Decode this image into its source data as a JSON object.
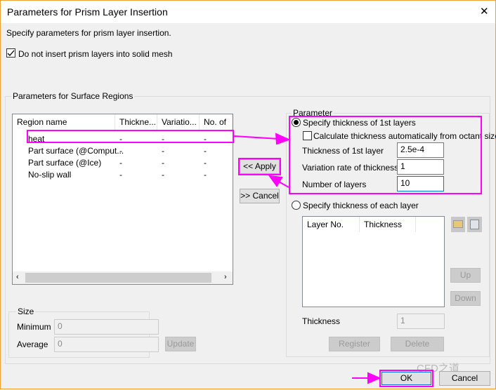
{
  "window": {
    "title": "Parameters for Prism Layer Insertion",
    "close": "✕"
  },
  "description": "Specify parameters for prism layer insertion.",
  "no_solid_checkbox": {
    "label": "Do not insert prism layers into solid mesh",
    "checked": true
  },
  "surface_group": {
    "label": "Parameters for Surface Regions",
    "columns": [
      "Region name",
      "Thickne...",
      "Variatio...",
      "No. of l..."
    ],
    "rows": [
      [
        "heat",
        "-",
        "-",
        "-"
      ],
      [
        "Part surface (@Comput...",
        "-",
        "-",
        "-"
      ],
      [
        "Part surface (@Ice)",
        "-",
        "-",
        "-"
      ],
      [
        "No-slip wall",
        "-",
        "-",
        "-"
      ]
    ]
  },
  "size": {
    "label": "Size",
    "minimum_label": "Minimum",
    "minimum": "0",
    "average_label": "Average",
    "average": "0",
    "update": "Update"
  },
  "apply": "<< Apply",
  "cancel_move": ">> Cancel",
  "parameter": {
    "label": "Parameter",
    "radio1": "Specify thickness of 1st layers",
    "auto_check": "Calculate thickness automatically from octant size",
    "thickness_label": "Thickness of 1st layer",
    "thickness": "2.5e-4",
    "variation_label": "Variation rate of thickness",
    "variation": "1",
    "layers_label": "Number of layers",
    "layers": "10",
    "radio2": "Specify thickness of each layer",
    "layer_columns": [
      "Layer No.",
      "Thickness"
    ],
    "up": "Up",
    "down": "Down",
    "thick2_label": "Thickness",
    "thick2": "1",
    "register": "Register",
    "delete": "Delete"
  },
  "ok": "OK",
  "cancel": "Cancel",
  "watermark": "CFD之道",
  "accent": "#ff00ff"
}
